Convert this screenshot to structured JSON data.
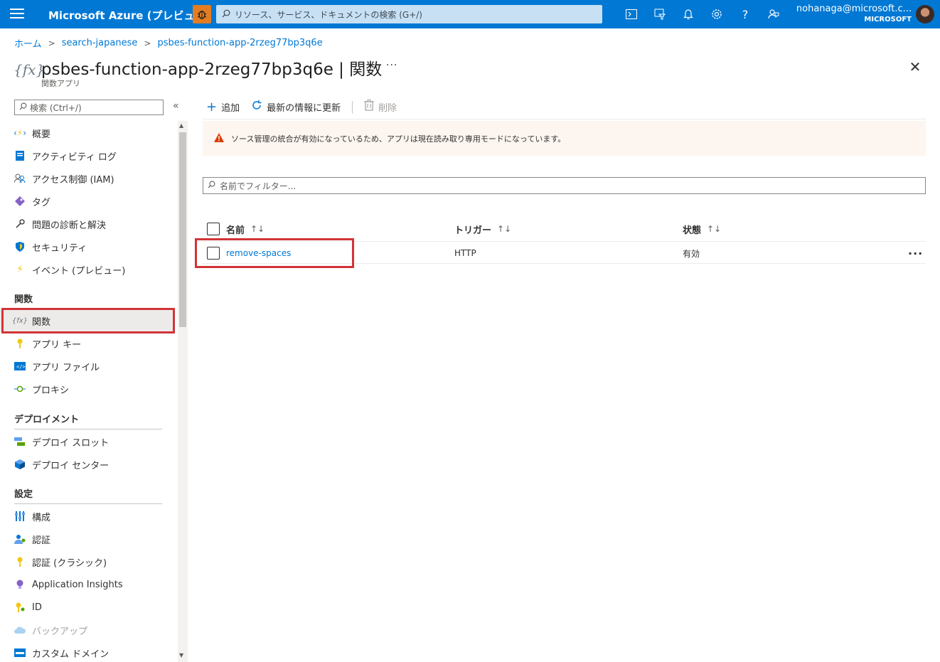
{
  "topbar": {
    "brand": "Microsoft Azure (プレビュー)",
    "search_placeholder": "リソース、サービス、ドキュメントの検索 (G+/)",
    "account_email": "nohanaga@microsoft.c...",
    "account_org": "MICROSOFT",
    "icons": [
      "cloud-shell-icon",
      "directory-filter-icon",
      "bell-icon",
      "gear-icon",
      "help-icon",
      "feedback-icon"
    ]
  },
  "breadcrumb": [
    "ホーム",
    "search-japanese",
    "psbes-function-app-2rzeg77bp3q6e"
  ],
  "header": {
    "title": "psbes-function-app-2rzeg77bp3q6e | 関数",
    "subtitle": "関数アプリ",
    "more": "···",
    "close": "✕"
  },
  "sidebar": {
    "search_placeholder": "検索 (Ctrl+/)",
    "collapse": "«",
    "items_top": [
      "概要",
      "アクティビティ ログ",
      "アクセス制御 (IAM)",
      "タグ",
      "問題の診断と解決",
      "セキュリティ",
      "イベント (プレビュー)"
    ],
    "section_functions": "関数",
    "items_functions": [
      "関数",
      "アプリ キー",
      "アプリ ファイル",
      "プロキシ"
    ],
    "section_deploy": "デプロイメント",
    "items_deploy": [
      "デプロイ スロット",
      "デプロイ センター"
    ],
    "section_settings": "設定",
    "items_settings": [
      "構成",
      "認証",
      "認証 (クラシック)",
      "Application Insights",
      "ID",
      "バックアップ",
      "カスタム ドメイン"
    ]
  },
  "toolbar": {
    "add": "追加",
    "refresh": "最新の情報に更新",
    "delete": "削除"
  },
  "warning": {
    "text": "ソース管理の統合が有効になっているため、アプリは現在読み取り専用モードになっています。"
  },
  "filter": {
    "placeholder": "名前でフィルター..."
  },
  "grid": {
    "columns": [
      "名前",
      "トリガー",
      "状態"
    ],
    "rows": [
      {
        "name": "remove-spaces",
        "trigger": "HTTP",
        "status": "有効"
      }
    ]
  },
  "colors": {
    "accent": "#0078d4",
    "highlight": "#d13438",
    "warning_icon": "#d83b01"
  }
}
